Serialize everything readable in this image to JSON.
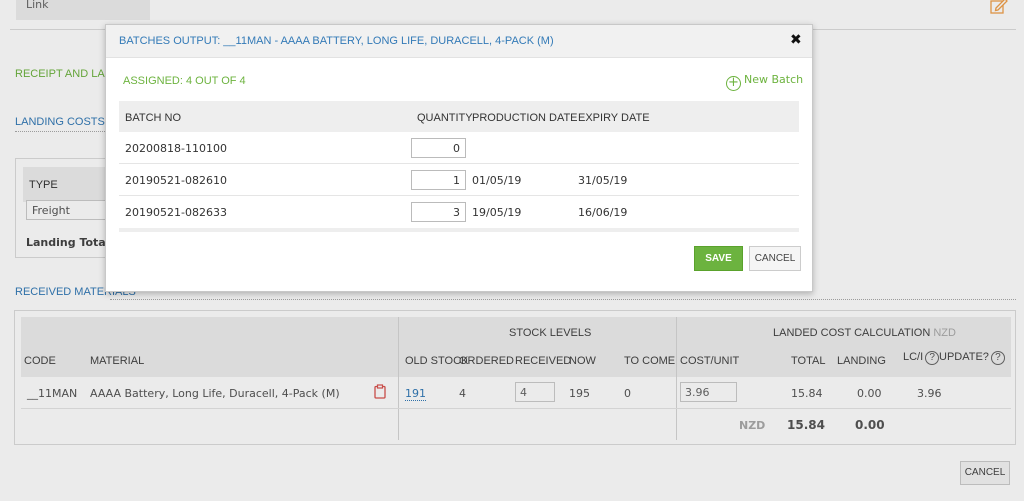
{
  "background": {
    "link_label": "Link",
    "receipt_section": "RECEIPT AND LAND",
    "landing_costs_section": "LANDING COSTS",
    "landing_costs_table": {
      "type_header": "TYPE",
      "freight_value": "Freight",
      "landing_total_label": "Landing Total"
    },
    "received_materials_section": "RECEIVED MATERIALS",
    "received_materials": {
      "group_headers": {
        "stock_levels": "STOCK LEVELS",
        "landed_cost": "LANDED COST CALCULATION",
        "landed_cost_currency": "NZD"
      },
      "columns": {
        "code": "CODE",
        "material": "MATERIAL",
        "old_stock": "OLD STOCK",
        "ordered": "ORDERED",
        "received": "RECEIVED",
        "now": "NOW",
        "to_come": "TO COME",
        "cost_unit": "COST/UNIT",
        "total": "TOTAL",
        "landing": "LANDING",
        "lci": "LC/I",
        "update": "UPDATE?"
      },
      "row": {
        "code": "__11MAN",
        "material": "AAAA Battery, Long Life, Duracell, 4-Pack (M)",
        "old_stock": "191",
        "ordered": "4",
        "received": "4",
        "now": "195",
        "to_come": "0",
        "cost_unit": "3.96",
        "total": "15.84",
        "landing": "0.00",
        "lci": "3.96"
      },
      "footer": {
        "currency": "NZD",
        "total": "15.84",
        "landing": "0.00"
      }
    },
    "cancel_label": "CANCEL",
    "help_glyph": "?"
  },
  "modal": {
    "title": "BATCHES OUTPUT: __11MAN - AAAA BATTERY, LONG LIFE, DURACELL, 4-PACK (M)",
    "close_glyph": "✖",
    "assigned": "ASSIGNED: 4 OUT OF 4",
    "new_batch_label": "New Batch",
    "plus_glyph": "+",
    "columns": {
      "batch_no": "BATCH NO",
      "quantity": "QUANTITY",
      "production_date": "PRODUCTION DATE",
      "expiry_date": "EXPIRY DATE"
    },
    "batches": [
      {
        "batch_no": "20200818-110100",
        "quantity": "0",
        "production_date": "",
        "expiry_date": ""
      },
      {
        "batch_no": "20190521-082610",
        "quantity": "1",
        "production_date": "01/05/19",
        "expiry_date": "31/05/19"
      },
      {
        "batch_no": "20190521-082633",
        "quantity": "3",
        "production_date": "19/05/19",
        "expiry_date": "16/06/19"
      }
    ],
    "save_label": "SAVE",
    "cancel_label": "CANCEL"
  },
  "colors": {
    "accent_green": "#6db33f",
    "link_blue": "#337ab7",
    "delete_red": "#d9534f"
  }
}
